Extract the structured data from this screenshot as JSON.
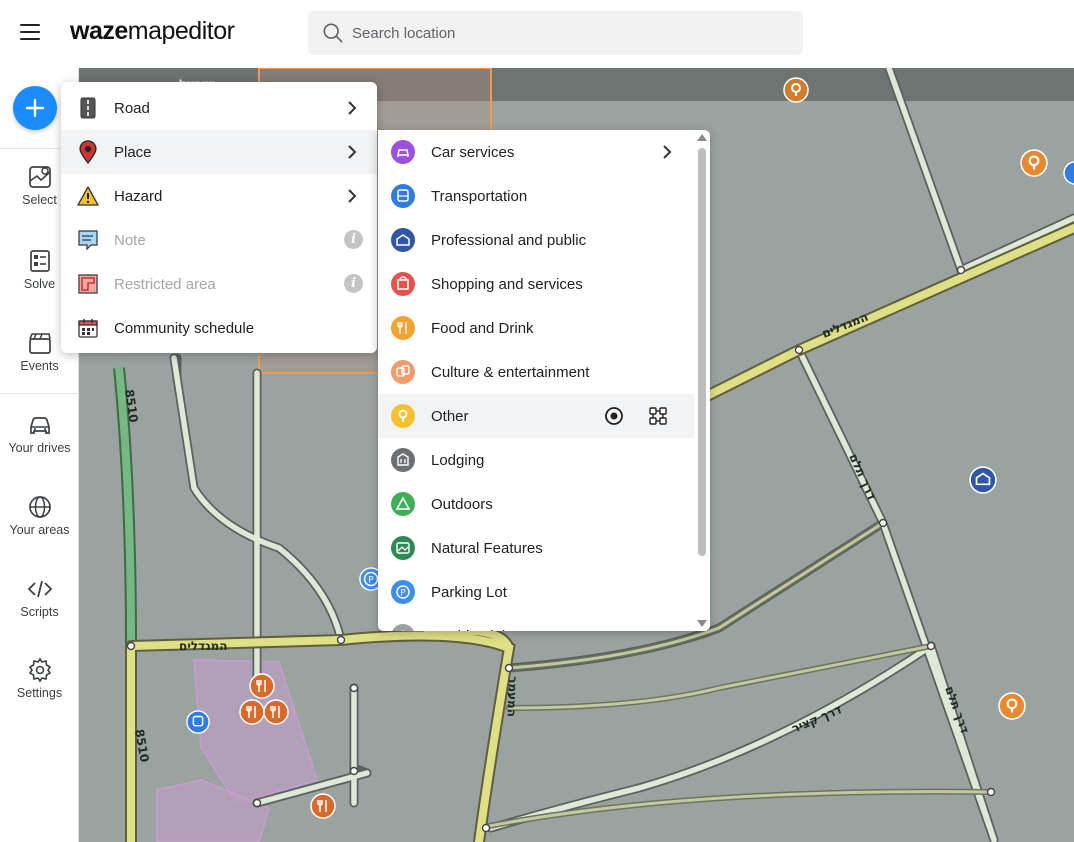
{
  "app": {
    "logo_bold": "waze",
    "logo_light": "mapeditor"
  },
  "search": {
    "placeholder": "Search location"
  },
  "sidebar": {
    "items": [
      {
        "label": "Select"
      },
      {
        "label": "Solve"
      },
      {
        "label": "Events"
      },
      {
        "label": "Your drives"
      },
      {
        "label": "Your areas"
      },
      {
        "label": "Scripts"
      },
      {
        "label": "Settings"
      }
    ]
  },
  "add_menu": {
    "items": [
      {
        "label": "Road",
        "icon": "road-icon"
      },
      {
        "label": "Place",
        "icon": "place-pin-icon"
      },
      {
        "label": "Hazard",
        "icon": "hazard-warning-icon"
      },
      {
        "label": "Note",
        "icon": "note-icon"
      },
      {
        "label": "Restricted area",
        "icon": "restricted-area-icon"
      },
      {
        "label": "Community schedule",
        "icon": "calendar-icon"
      }
    ]
  },
  "place_submenu": {
    "items": [
      {
        "label": "Car services",
        "color": "#9b51e0"
      },
      {
        "label": "Transportation",
        "color": "#2f7de1"
      },
      {
        "label": "Professional and public",
        "color": "#3056a8"
      },
      {
        "label": "Shopping and services",
        "color": "#e5534b"
      },
      {
        "label": "Food and Drink",
        "color": "#f2a132"
      },
      {
        "label": "Culture & entertainment",
        "color": "#f29b6b"
      },
      {
        "label": "Other",
        "color": "#f5c12e"
      },
      {
        "label": "Lodging",
        "color": "#6b7075"
      },
      {
        "label": "Outdoors",
        "color": "#3fae5a"
      },
      {
        "label": "Natural Features",
        "color": "#2e8b57"
      },
      {
        "label": "Parking Lot",
        "color": "#3d8ef0"
      },
      {
        "label": "Residential",
        "color": "#9aa0a6"
      }
    ]
  },
  "map_labels": {
    "road_8510_a": "8510",
    "road_8510_b": "8510",
    "hamagdalim_a": "המגדלים",
    "hamagdalim_b": "המגדלים",
    "derech_tlm": "דרך תלם",
    "derech_tlm_b": "דרך תלם",
    "derech_katsir": "דרך קציר",
    "hamaamar": "המעמר",
    "top_label": "ישראל"
  }
}
